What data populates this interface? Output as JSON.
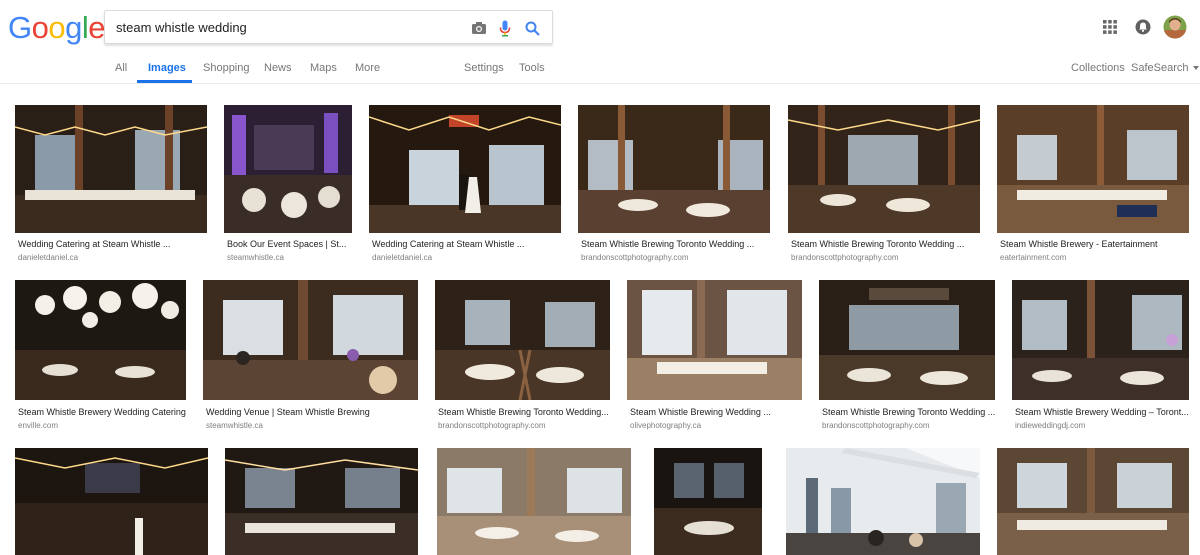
{
  "logo": [
    "G",
    "o",
    "o",
    "g",
    "l",
    "e"
  ],
  "logo_colors": [
    "#4285f4",
    "#ea4335",
    "#fbbc05",
    "#4285f4",
    "#34a853",
    "#ea4335"
  ],
  "search": {
    "query": "steam whistle wedding"
  },
  "icons": {
    "camera": "camera-icon",
    "mic": "mic-icon",
    "search": "search-icon",
    "apps": "apps-grid-icon",
    "notifications": "notifications-icon",
    "avatar": "avatar"
  },
  "nav": {
    "all": "All",
    "images": "Images",
    "shopping": "Shopping",
    "news": "News",
    "maps": "Maps",
    "more": "More",
    "settings": "Settings",
    "tools": "Tools",
    "collections": "Collections",
    "safesearch": "SafeSearch"
  },
  "accent": "#1a73e8",
  "results": [
    {
      "caption": "Wedding Catering at Steam Whistle ...",
      "source": "danieletdaniel.ca"
    },
    {
      "caption": "Book Our Event Spaces | St...",
      "source": "steamwhistle.ca"
    },
    {
      "caption": "Wedding Catering at Steam Whistle ...",
      "source": "danieletdaniel.ca"
    },
    {
      "caption": "Steam Whistle Brewing Toronto Wedding ...",
      "source": "brandonscottphotography.com"
    },
    {
      "caption": "Steam Whistle Brewing Toronto Wedding ...",
      "source": "brandonscottphotography.com"
    },
    {
      "caption": "Steam Whistle Brewery - Eatertainment",
      "source": "eatertainment.com"
    },
    {
      "caption": "Steam Whistle Brewery Wedding Catering",
      "source": "enville.com"
    },
    {
      "caption": "Wedding Venue | Steam Whistle Brewing",
      "source": "steamwhistle.ca"
    },
    {
      "caption": "Steam Whistle Brewing Toronto Wedding...",
      "source": "brandonscottphotography.com"
    },
    {
      "caption": "Steam Whistle Brewing Wedding ...",
      "source": "olivephotography.ca"
    },
    {
      "caption": "Steam Whistle Brewing Toronto Wedding ...",
      "source": "brandonscottphotography.com"
    },
    {
      "caption": "Steam Whistle Brewery Wedding – Toront...",
      "source": "indieweddingdj.com"
    }
  ]
}
